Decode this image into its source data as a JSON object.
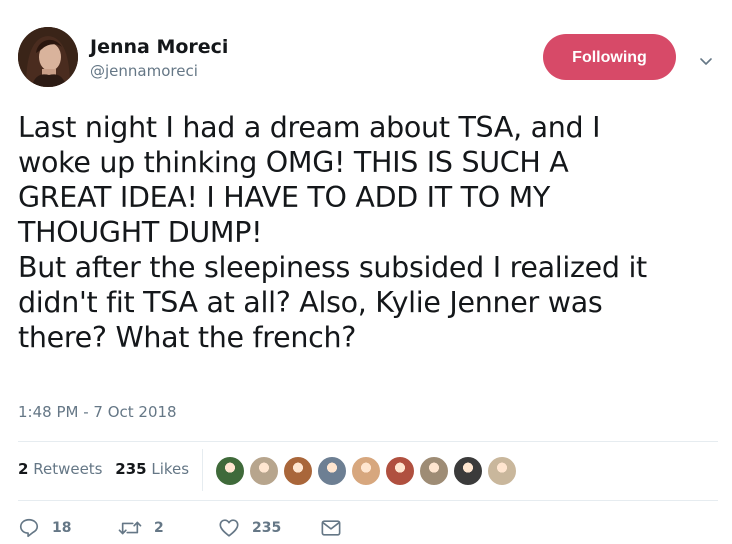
{
  "author": {
    "name": "Jenna Moreci",
    "handle": "@jennamoreci"
  },
  "follow_button": {
    "label": "Following",
    "color": "#d74a68"
  },
  "tweet": {
    "text": "Last night I had a dream about TSA, and I\nwoke up thinking OMG! THIS IS SUCH A\nGREAT IDEA! I HAVE TO ADD IT TO MY\nTHOUGHT DUMP!\nBut after the sleepiness subsided I realized it\ndidn't fit TSA at all? Also, Kylie Jenner was\nthere? What the french?",
    "timestamp": "1:48 PM - 7 Oct 2018"
  },
  "stats": {
    "retweets_count": "2",
    "retweets_label": "Retweets",
    "likes_count": "235",
    "likes_label": "Likes"
  },
  "likers": [
    {
      "icon": "liker-avatar",
      "color": "#3f6a3a"
    },
    {
      "icon": "liker-avatar",
      "color": "#b7a58d"
    },
    {
      "icon": "liker-avatar",
      "color": "#a9663a"
    },
    {
      "icon": "liker-avatar",
      "color": "#6d7f93"
    },
    {
      "icon": "liker-avatar",
      "color": "#d7a77e"
    },
    {
      "icon": "liker-avatar",
      "color": "#b0503f"
    },
    {
      "icon": "liker-avatar",
      "color": "#9e8c75"
    },
    {
      "icon": "liker-avatar",
      "color": "#3b3b3b"
    },
    {
      "icon": "liker-avatar",
      "color": "#c9b79c"
    }
  ],
  "actions": {
    "reply_count": "18",
    "retweet_count": "2",
    "like_count": "235"
  },
  "colors": {
    "text": "#14171a",
    "muted": "#657786",
    "divider": "#e6ecf0"
  }
}
